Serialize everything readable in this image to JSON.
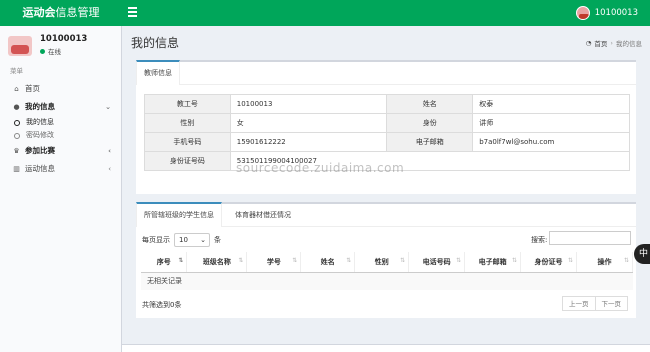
{
  "header": {
    "logo_bold": "运动会",
    "logo_rest": "信息管理",
    "user": "10100013"
  },
  "sidebar": {
    "user_name": "10100013",
    "status": "在线",
    "menu_header": "菜单",
    "items": {
      "home": "首页",
      "my_info": "我的信息",
      "my_info_sub1": "我的信息",
      "my_info_sub2": "密码修改",
      "join_game": "参加比赛",
      "sports_info": "运动信息"
    }
  },
  "content": {
    "title": "我的信息",
    "breadcrumb_home": "首页",
    "breadcrumb_current": "我的信息"
  },
  "profile": {
    "tab": "教师信息",
    "rows": [
      {
        "l1": "教工号",
        "v1": "10100013",
        "l2": "姓名",
        "v2": "权泰"
      },
      {
        "l1": "性别",
        "v1": "女",
        "l2": "身份",
        "v2": "讲师"
      },
      {
        "l1": "手机号码",
        "v1": "15901612222",
        "l2": "电子邮箱",
        "v2": "b7a0lf7wl@sohu.com"
      },
      {
        "l1": "身份证号码",
        "v1": "531501199004100027"
      }
    ]
  },
  "students": {
    "tab_active": "所管辖班级的学生信息",
    "tab_other": "体育器材借还情况",
    "page_size_prefix": "每页显示",
    "page_size_value": "10",
    "page_size_suffix": "条",
    "search_label": "搜索:",
    "columns": [
      "序号",
      "班级名称",
      "学号",
      "姓名",
      "性别",
      "电话号码",
      "电子邮箱",
      "身份证号",
      "操作"
    ],
    "empty_text": "无相关记录",
    "footer": "共筛选到0条",
    "prev": "上一页",
    "next": "下一页"
  },
  "watermark": "sourcecode.zuidaima.com",
  "side_badge": "中",
  "colors": {
    "header_green": "#00a65a",
    "tab_blue": "#3c8dbc",
    "content_bg": "#ecf0f5"
  }
}
